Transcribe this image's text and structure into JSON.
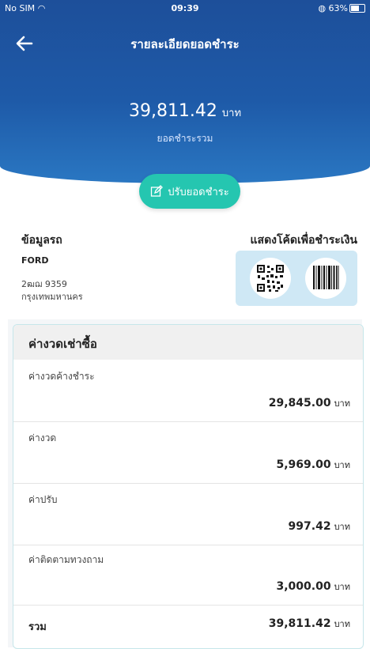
{
  "status_bar": {
    "carrier": "No SIM",
    "time": "09:39",
    "battery": "63%",
    "battery_level": 0.63
  },
  "header": {
    "title": "รายละเอียดยอดชำระ"
  },
  "summary": {
    "amount": "39,811.42",
    "unit": "บาท",
    "label": "ยอดชำระรวม"
  },
  "adjust_button": {
    "label": "ปรับยอดชำระ"
  },
  "car": {
    "title": "ข้อมูลรถ",
    "brand": "FORD",
    "plate": "2ฒฌ 9359",
    "province": "กรุงเทพมหานคร"
  },
  "payment_code": {
    "title": "แสดงโค้ดเพื่อชำระเงิน"
  },
  "installment": {
    "title": "ค่างวดเช่าซื้อ",
    "items": [
      {
        "label": "ค่างวดค้างชำระ",
        "amount": "29,845.00",
        "unit": "บาท"
      },
      {
        "label": "ค่างวด",
        "amount": "5,969.00",
        "unit": "บาท"
      },
      {
        "label": "ค่าปรับ",
        "amount": "997.42",
        "unit": "บาท"
      },
      {
        "label": "ค่าติดตามทวงถาม",
        "amount": "3,000.00",
        "unit": "บาท"
      }
    ],
    "total": {
      "label": "รวม",
      "amount": "39,811.42",
      "unit": "บาท"
    }
  },
  "colors": {
    "header_top": "#1d4f9a",
    "header_bottom": "#2a77c2",
    "accent": "#25c6b0",
    "code_bg": "#cfe8f5"
  }
}
